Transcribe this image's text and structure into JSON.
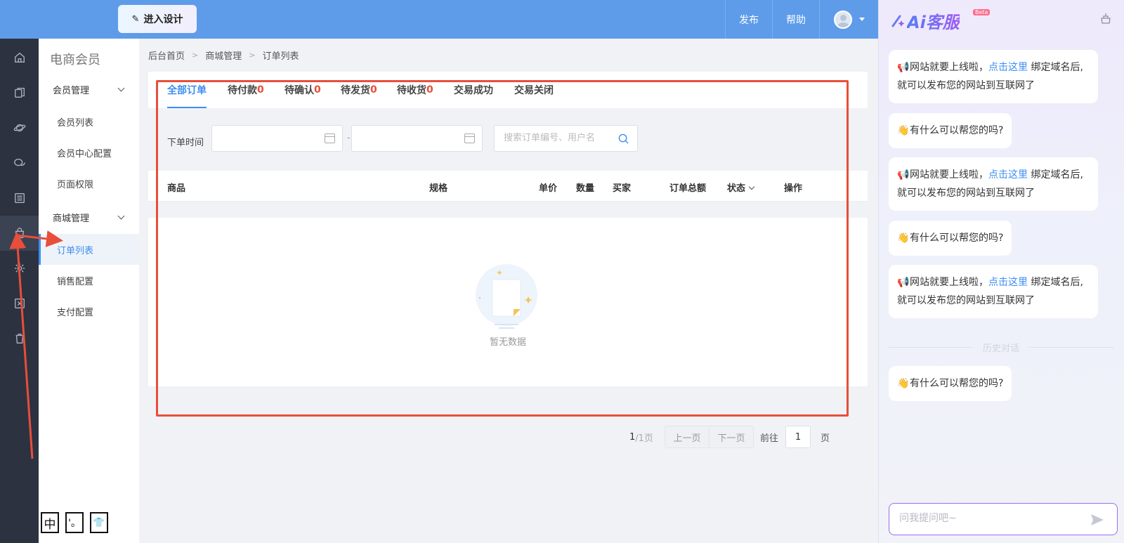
{
  "topbar": {
    "design_label": "进入设计",
    "publish_label": "发布",
    "help_label": "帮助"
  },
  "sidebar": {
    "title": "电商会员",
    "groups": [
      {
        "label": "会员管理",
        "items": [
          "会员列表",
          "会员中心配置",
          "页面权限"
        ]
      },
      {
        "label": "商城管理",
        "items": [
          "订单列表",
          "销售配置",
          "支付配置"
        ]
      }
    ],
    "active_item": "订单列表"
  },
  "rail": {
    "icons": [
      "home-icon",
      "copy-icon",
      "planet-icon",
      "chat-icon",
      "list-icon",
      "bag-icon",
      "gear-icon",
      "box-icon",
      "trash-icon"
    ],
    "active_index": 5
  },
  "breadcrumb": [
    "后台首页",
    "商城管理",
    "订单列表"
  ],
  "tabs": [
    {
      "label": "全部订单",
      "count": ""
    },
    {
      "label": "待付款",
      "count": "0"
    },
    {
      "label": "待确认",
      "count": "0"
    },
    {
      "label": "待发货",
      "count": "0"
    },
    {
      "label": "待收货",
      "count": "0"
    },
    {
      "label": "交易成功",
      "count": ""
    },
    {
      "label": "交易关闭",
      "count": ""
    }
  ],
  "filter": {
    "label": "下单时间",
    "dash": "-",
    "search_placeholder": "搜索订单编号、用户名"
  },
  "table": {
    "columns": [
      "商品",
      "规格",
      "单价",
      "数量",
      "买家",
      "订单总额",
      "状态",
      "操作"
    ],
    "empty_text": "暂无数据"
  },
  "pager": {
    "current": "1",
    "total": "/1页",
    "prev": "上一页",
    "next": "下一页",
    "goto": "前往",
    "page_value": "1",
    "unit": "页"
  },
  "chat": {
    "brand": "Ai客服",
    "beta": "Beta",
    "messages": [
      {
        "pre": "网站就要上线啦，",
        "link": "点击这里",
        "post": "绑定域名后,就可以发布您的网站到互联网了"
      },
      {
        "text": "有什么可以帮您的吗?"
      },
      {
        "pre": "网站就要上线啦，",
        "link": "点击这里",
        "post": "绑定域名后,就可以发布您的网站到互联网了"
      },
      {
        "text": "有什么可以帮您的吗?"
      },
      {
        "pre": "网站就要上线啦，",
        "link": "点击这里",
        "post": "绑定域名后,就可以发布您的网站到互联网了"
      },
      {
        "text": "有什么可以帮您的吗?"
      }
    ],
    "history_label": "历史对话",
    "input_placeholder": "问我提问吧~"
  },
  "ime": [
    "中",
    "'。",
    "👕"
  ],
  "colors": {
    "topbar": "#5e9cea",
    "accent": "#3d8ef0",
    "count": "#e84e3a",
    "rail": "#2c3240",
    "annotation": "#e84e3a"
  }
}
